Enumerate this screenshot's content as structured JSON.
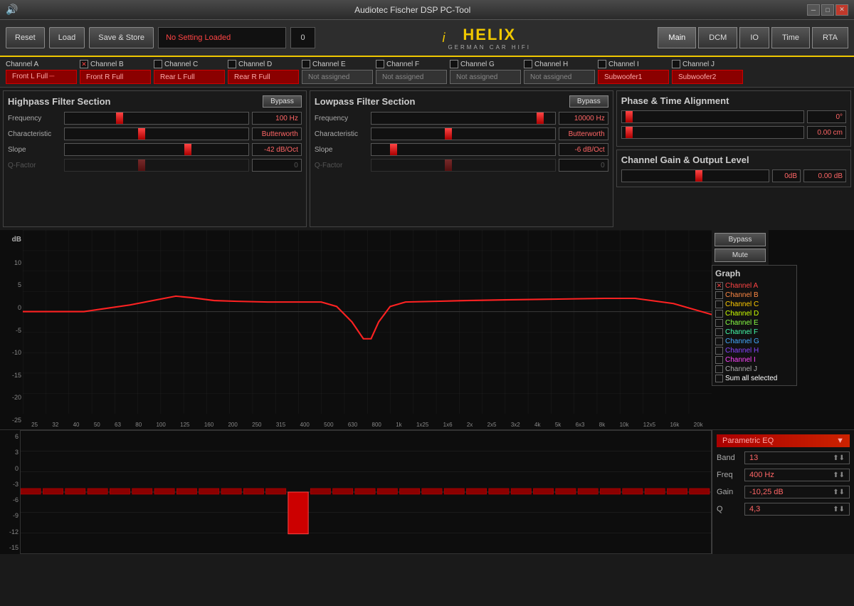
{
  "window": {
    "title": "Audiotec Fischer DSP PC-Tool",
    "icon": "speaker-icon"
  },
  "toolbar": {
    "reset_label": "Reset",
    "load_label": "Load",
    "save_label": "Save & Store",
    "status_text": "No Setting Loaded",
    "status_num": "0",
    "nav": {
      "main": "Main",
      "dcm": "DCM",
      "io": "IO",
      "time": "Time",
      "rta": "RTA"
    }
  },
  "helix": {
    "logo": "i",
    "brand": "HELIX",
    "sub": "GERMAN CAR HIFI"
  },
  "channels": [
    {
      "name": "Channel A",
      "checked": true,
      "label": "Front L Full",
      "active": true
    },
    {
      "name": "Channel B",
      "checked": true,
      "label": "Front R Full",
      "active": true
    },
    {
      "name": "Channel C",
      "checked": false,
      "label": "Rear L Full",
      "active": true
    },
    {
      "name": "Channel D",
      "checked": false,
      "label": "Rear R Full",
      "active": true
    },
    {
      "name": "Channel E",
      "checked": false,
      "label": "Not assigned",
      "active": false
    },
    {
      "name": "Channel F",
      "checked": false,
      "label": "Not assigned",
      "active": false
    },
    {
      "name": "Channel G",
      "checked": false,
      "label": "Not assigned",
      "active": false
    },
    {
      "name": "Channel H",
      "checked": false,
      "label": "Not assigned",
      "active": false
    },
    {
      "name": "Channel I",
      "checked": false,
      "label": "Subwoofer1",
      "active": true
    },
    {
      "name": "Channel J",
      "checked": false,
      "label": "Subwoofer2",
      "active": true
    }
  ],
  "highpass": {
    "title": "Highpass Filter Section",
    "bypass_label": "Bypass",
    "frequency": {
      "label": "Frequency",
      "value": "100 Hz"
    },
    "characteristic": {
      "label": "Characteristic",
      "value": "Butterworth"
    },
    "slope": {
      "label": "Slope",
      "value": "-42 dB/Oct"
    },
    "qfactor": {
      "label": "Q-Factor",
      "value": "0"
    }
  },
  "lowpass": {
    "title": "Lowpass Filter Section",
    "bypass_label": "Bypass",
    "frequency": {
      "label": "Frequency",
      "value": "10000 Hz"
    },
    "characteristic": {
      "label": "Characteristic",
      "value": "Butterworth"
    },
    "slope": {
      "label": "Slope",
      "value": "-6 dB/Oct"
    },
    "qfactor": {
      "label": "Q-Factor",
      "value": "0"
    }
  },
  "phase_time": {
    "title": "Phase & Time Alignment",
    "phase_value": "0°",
    "distance_value": "0.00 cm"
  },
  "channel_gain": {
    "title": "Channel Gain & Output Level",
    "gain_db": "0dB",
    "output_db": "0.00 dB"
  },
  "graph": {
    "title": "Graph",
    "bypass_label": "Bypass",
    "mute_label": "Mute",
    "y_labels": [
      "10",
      "5",
      "0",
      "-5",
      "-10",
      "-15",
      "-20",
      "-25"
    ],
    "db_label": "dB",
    "x_labels": [
      "25",
      "32",
      "40",
      "50",
      "63",
      "80",
      "100",
      "125",
      "160",
      "200",
      "250",
      "315",
      "400",
      "500",
      "630",
      "800",
      "1k",
      "1x25",
      "1x6",
      "2x",
      "2x5",
      "3x2",
      "4k",
      "5k",
      "6x3",
      "8k",
      "10k",
      "12x5",
      "16k",
      "20k"
    ],
    "channels": [
      {
        "name": "Channel A",
        "color": "#ff4444",
        "checked": true
      },
      {
        "name": "Channel B",
        "color": "#ff8844",
        "checked": false
      },
      {
        "name": "Channel C",
        "color": "#ffcc44",
        "checked": false
      },
      {
        "name": "Channel D",
        "color": "#ccff00",
        "checked": false
      },
      {
        "name": "Channel E",
        "color": "#88ff44",
        "checked": false
      },
      {
        "name": "Channel F",
        "color": "#44ffaa",
        "checked": false
      },
      {
        "name": "Channel G",
        "color": "#44aaff",
        "checked": false
      },
      {
        "name": "Channel H",
        "color": "#8844ff",
        "checked": false
      },
      {
        "name": "Channel I",
        "color": "#ff44ff",
        "checked": false
      },
      {
        "name": "Channel J",
        "color": "#aaaaaa",
        "checked": false
      },
      {
        "name": "Sum all selected",
        "color": "#ffffff",
        "checked": false
      }
    ]
  },
  "eq_panel": {
    "title": "Parametric EQ",
    "band_label": "Band",
    "band_value": "13",
    "freq_label": "Freq",
    "freq_value": "400 Hz",
    "gain_label": "Gain",
    "gain_value": "-10,25 dB",
    "q_label": "Q",
    "q_value": "4,3"
  },
  "eq_bars": {
    "y_labels": [
      "6",
      "3",
      "0",
      "-3",
      "-6",
      "-9",
      "-12",
      "-15"
    ],
    "bar_count": 31,
    "active_bar": 13,
    "active_value": -10.25
  }
}
